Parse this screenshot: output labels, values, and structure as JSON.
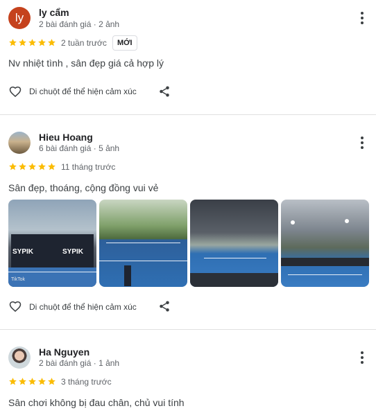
{
  "reviews": [
    {
      "avatar_letter": "ly",
      "name": "ly cẩm",
      "meta": "2 bài đánh giá · 2 ảnh",
      "rating": 5,
      "when": "2 tuần trước",
      "badge": "MỚI",
      "text": "Nv nhiệt tình , sân đẹp giá cả hợp lý",
      "like_label": "Di chuột để thể hiện cảm xúc"
    },
    {
      "name": "Hieu Hoang",
      "meta": "6 bài đánh giá · 5 ảnh",
      "rating": 5,
      "when": "11 tháng trước",
      "text": "Sân đẹp, thoáng, cộng đồng vui vẻ",
      "like_label": "Di chuột để thể hiện cảm xúc",
      "photos": [
        {
          "sign_left": "SYPIK",
          "sign_right": "SYPIK",
          "watermark": "TikTok"
        },
        {
          "scene": "outdoor-blue-court"
        },
        {
          "scene": "covered-court-wide"
        },
        {
          "scene": "covered-court-lights"
        }
      ]
    },
    {
      "name": "Ha Nguyen",
      "meta": "2 bài đánh giá · 1 ảnh",
      "rating": 5,
      "when": "3 tháng trước",
      "text": "Sân chơi không bị đau chân, chủ vui tính"
    }
  ],
  "colors": {
    "star": "#fbbc04",
    "avatar_ly": "#c5421d",
    "court_blue": "#2f6fb3",
    "divider": "#e0e0e0"
  },
  "icons": {
    "more": "more-vert-icon",
    "heart": "heart-outline-icon",
    "share": "share-icon",
    "star": "star-icon"
  }
}
